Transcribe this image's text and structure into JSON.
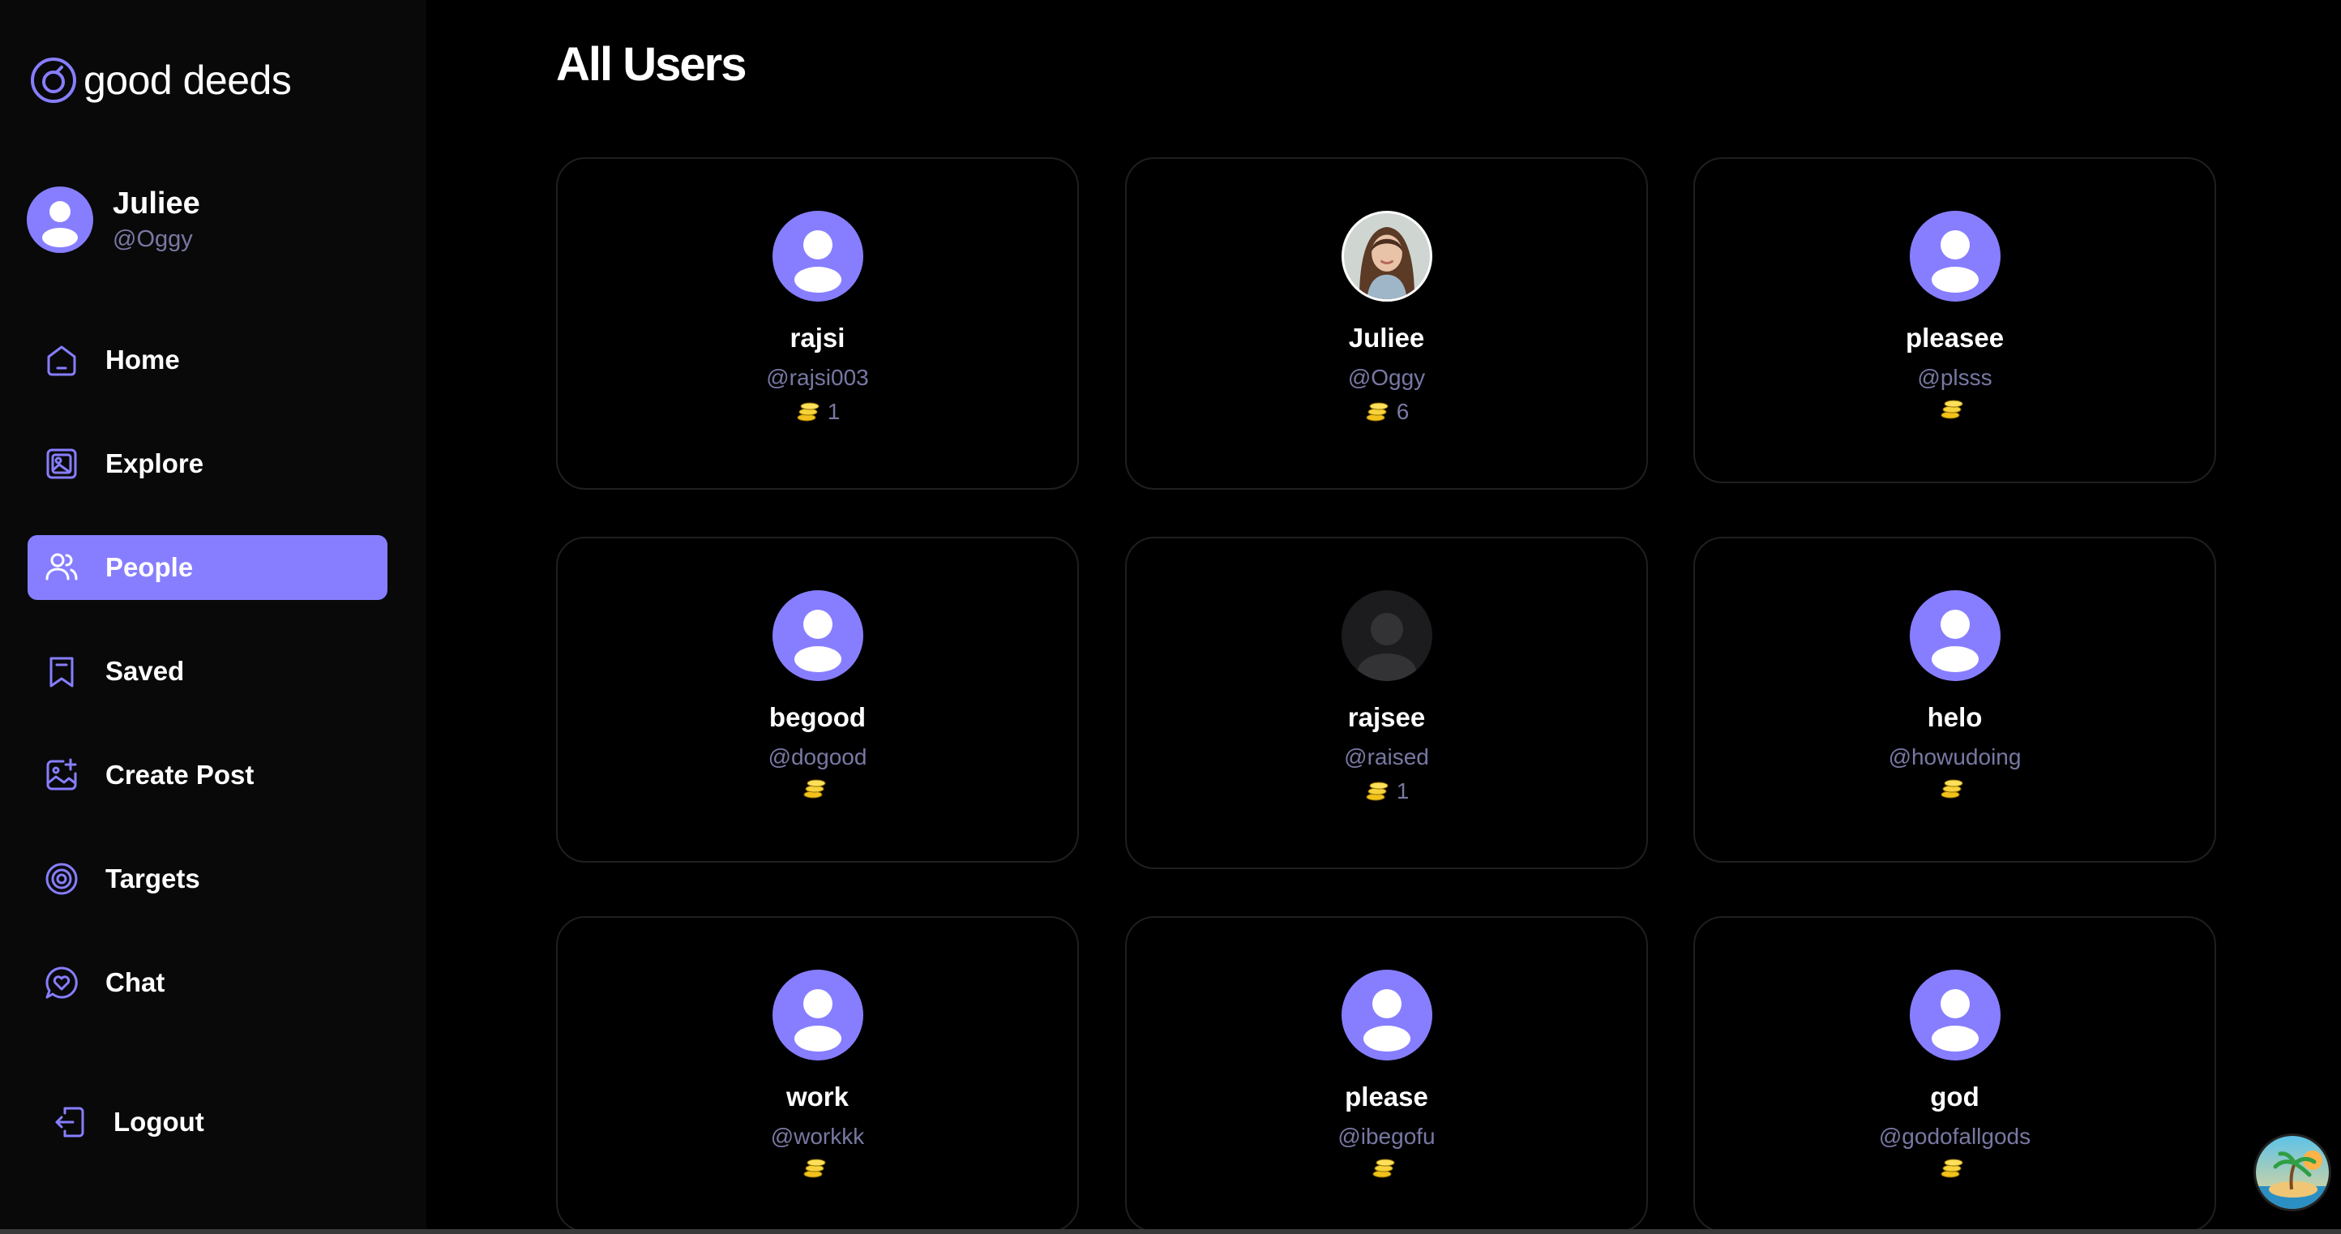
{
  "app": {
    "name": "good deeds",
    "accent": "#877eff"
  },
  "profile": {
    "name": "Juliee",
    "handle": "@Oggy"
  },
  "nav": [
    {
      "label": "Home",
      "icon": "home-icon",
      "active": false
    },
    {
      "label": "Explore",
      "icon": "gallery-icon",
      "active": false
    },
    {
      "label": "People",
      "icon": "people-icon",
      "active": true
    },
    {
      "label": "Saved",
      "icon": "bookmark-icon",
      "active": false
    },
    {
      "label": "Create Post",
      "icon": "add-image-icon",
      "active": false
    },
    {
      "label": "Targets",
      "icon": "target-icon",
      "active": false
    },
    {
      "label": "Chat",
      "icon": "chat-heart-icon",
      "active": false
    }
  ],
  "logout": {
    "label": "Logout"
  },
  "main": {
    "title": "All Users",
    "users": [
      {
        "name": "rajsi",
        "handle": "@rajsi003",
        "coins": "1",
        "avatar": "default"
      },
      {
        "name": "Juliee",
        "handle": "@Oggy",
        "coins": "6",
        "avatar": "photo"
      },
      {
        "name": "pleasee",
        "handle": "@plsss",
        "coins": "",
        "avatar": "default"
      },
      {
        "name": "begood",
        "handle": "@dogood",
        "coins": "",
        "avatar": "default"
      },
      {
        "name": "rajsee",
        "handle": "@raised",
        "coins": "1",
        "avatar": "dark"
      },
      {
        "name": "helo",
        "handle": "@howudoing",
        "coins": "",
        "avatar": "default"
      },
      {
        "name": "work",
        "handle": "@workkk",
        "coins": "",
        "avatar": "default"
      },
      {
        "name": "please",
        "handle": "@ibegofu",
        "coins": "",
        "avatar": "default"
      },
      {
        "name": "god",
        "handle": "@godofallgods",
        "coins": "",
        "avatar": "default"
      }
    ]
  }
}
